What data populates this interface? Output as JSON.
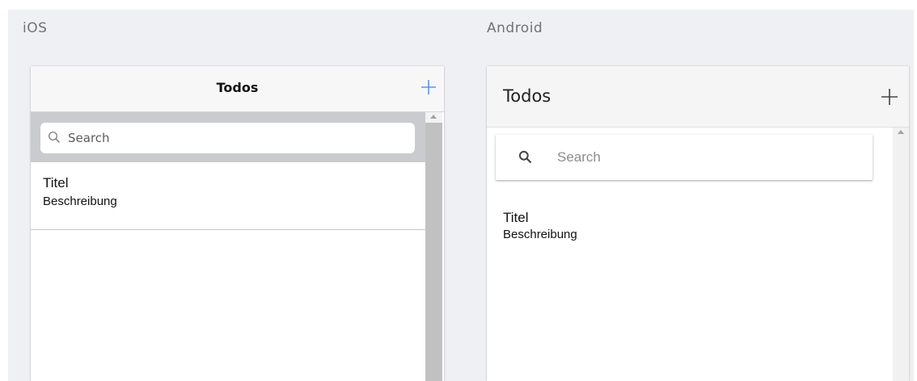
{
  "ios": {
    "platform_label": "iOS",
    "title": "Todos",
    "add_icon": "plus-icon",
    "search": {
      "placeholder": "Search",
      "icon": "search-icon"
    },
    "items": [
      {
        "title": "Titel",
        "description": "Beschreibung"
      }
    ],
    "colors": {
      "accent": "#3b82f6",
      "nav_bg": "#f7f7f8",
      "search_bar_bg": "#cacbce"
    }
  },
  "android": {
    "platform_label": "Android",
    "title": "Todos",
    "add_icon": "plus-icon",
    "search": {
      "placeholder": "Search",
      "icon": "search-icon"
    },
    "items": [
      {
        "title": "Titel",
        "description": "Beschreibung"
      }
    ],
    "colors": {
      "appbar_bg": "#f5f5f5",
      "icon": "#444444"
    }
  }
}
